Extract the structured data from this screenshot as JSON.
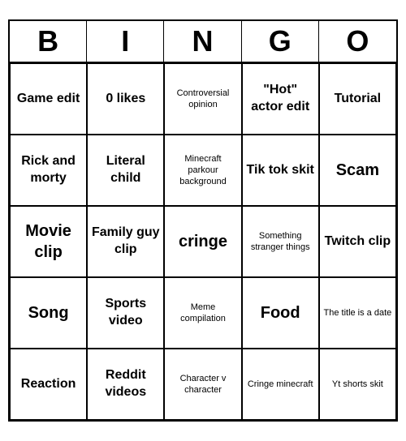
{
  "header": {
    "letters": [
      "B",
      "I",
      "N",
      "G",
      "O"
    ]
  },
  "cells": [
    {
      "text": "Game edit",
      "size": "medium"
    },
    {
      "text": "0 likes",
      "size": "medium"
    },
    {
      "text": "Controversial opinion",
      "size": "small"
    },
    {
      "text": "\"Hot\" actor edit",
      "size": "medium"
    },
    {
      "text": "Tutorial",
      "size": "medium"
    },
    {
      "text": "Rick and morty",
      "size": "medium"
    },
    {
      "text": "Literal child",
      "size": "medium"
    },
    {
      "text": "Minecraft parkour background",
      "size": "small"
    },
    {
      "text": "Tik tok skit",
      "size": "medium"
    },
    {
      "text": "Scam",
      "size": "large"
    },
    {
      "text": "Movie clip",
      "size": "large"
    },
    {
      "text": "Family guy clip",
      "size": "medium"
    },
    {
      "text": "cringe",
      "size": "large"
    },
    {
      "text": "Something stranger things",
      "size": "small"
    },
    {
      "text": "Twitch clip",
      "size": "medium"
    },
    {
      "text": "Song",
      "size": "large"
    },
    {
      "text": "Sports video",
      "size": "medium"
    },
    {
      "text": "Meme compilation",
      "size": "small"
    },
    {
      "text": "Food",
      "size": "large"
    },
    {
      "text": "The title is a date",
      "size": "small"
    },
    {
      "text": "Reaction",
      "size": "medium"
    },
    {
      "text": "Reddit videos",
      "size": "medium"
    },
    {
      "text": "Character v character",
      "size": "small"
    },
    {
      "text": "Cringe minecraft",
      "size": "small"
    },
    {
      "text": "Yt shorts skit",
      "size": "small"
    }
  ]
}
